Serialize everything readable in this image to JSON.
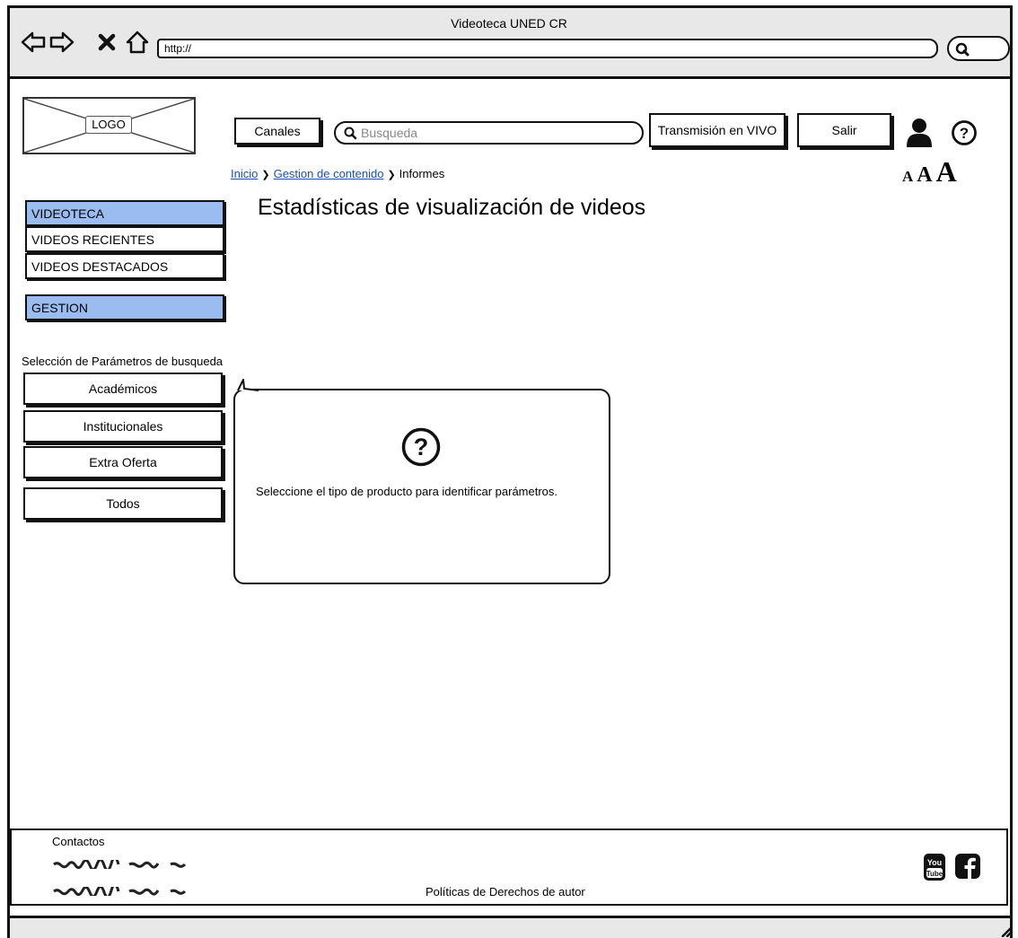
{
  "browser": {
    "title": "Videoteca UNED CR",
    "url": "http://"
  },
  "header": {
    "logo_label": "LOGO",
    "canales_label": "Canales",
    "search_placeholder": "Busqueda",
    "vivo_label": "Transmisión en VIVO",
    "salir_label": "Salir",
    "font_sizes": [
      "A",
      "A",
      "A"
    ]
  },
  "breadcrumb": {
    "items": [
      "Inicio",
      "Gestion de contenido",
      "Informes"
    ]
  },
  "page_title": "Estadísticas de visualización de videos",
  "sidebar": {
    "items": [
      "VIDEOTECA",
      "VIDEOS RECIENTES",
      "VIDEOS DESTACADOS",
      "GESTION"
    ],
    "params_label": "Selección de Parámetros de busqueda",
    "buttons": [
      "Académicos",
      "Institucionales",
      "Extra Oferta",
      "Todos"
    ]
  },
  "callout": {
    "text": "Seleccione el tipo de producto para identificar parámetros."
  },
  "footer": {
    "contactos": "Contactos",
    "policies": "Políticas de Derechos de autor"
  },
  "colors": {
    "accent_blue": "#9bbcf0",
    "link": "#1a4fb5",
    "chrome_gray": "#e8e8e8"
  }
}
